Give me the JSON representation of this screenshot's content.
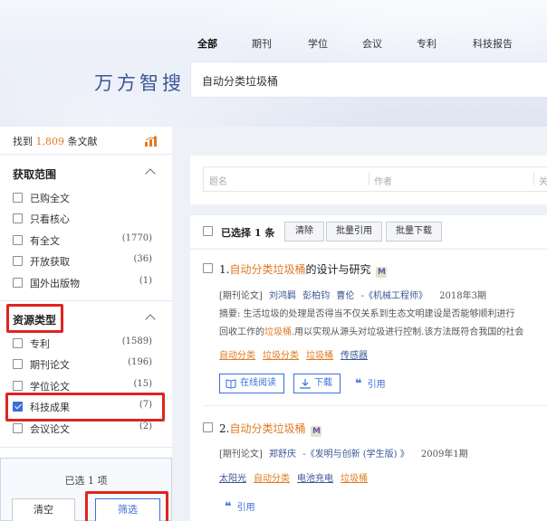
{
  "nav": [
    "全部",
    "期刊",
    "学位",
    "会议",
    "专利",
    "科技报告"
  ],
  "logo": "万方智搜",
  "search": {
    "value": "自动分类垃圾桶"
  },
  "found": {
    "prefix": "找到",
    "count": "1,809",
    "suffix": "条文献"
  },
  "filters": {
    "scope": {
      "title": "获取范围",
      "items": [
        {
          "label": "已购全文",
          "count": ""
        },
        {
          "label": "只看核心",
          "count": ""
        },
        {
          "label": "有全文",
          "count": "(1770)"
        },
        {
          "label": "开放获取",
          "count": "(36)"
        },
        {
          "label": "国外出版物",
          "count": "(1)"
        }
      ]
    },
    "type": {
      "title": "资源类型",
      "items": [
        {
          "label": "专利",
          "count": "(1589)",
          "checked": false
        },
        {
          "label": "期刊论文",
          "count": "(196)",
          "checked": false
        },
        {
          "label": "学位论文",
          "count": "(15)",
          "checked": false
        },
        {
          "label": "科技成果",
          "count": "(7)",
          "checked": true
        },
        {
          "label": "会议论文",
          "count": "(2)",
          "checked": false
        }
      ]
    }
  },
  "selection": {
    "text": "已选 1 项",
    "clear": "清空",
    "filter": "筛选"
  },
  "advanced": {
    "title_ph": "题名",
    "author_ph": "作者",
    "key_ph": "关"
  },
  "toolbar": {
    "selected": "已选择 1 条",
    "clear": "清除",
    "batch_cite": "批量引用",
    "batch_download": "批量下载"
  },
  "results": [
    {
      "num": "1.",
      "title_hl": "自动分类垃圾桶",
      "title_rest": "的设计与研究",
      "badge": "M",
      "type": "[期刊论文]",
      "authors": [
        "刘鸿羁",
        "彭柏钧",
        "曹伦"
      ],
      "journal": "-《机械工程师》",
      "date": "2018年3期",
      "abstract_1": "摘要: 生活垃圾的处理是否得当不仅关系到生态文明建设是否能够顺利进行",
      "abstract_2_pre": "回收工作的",
      "abstract_2_hl": "垃圾桶",
      "abstract_2_post": ".用以实现从源头对垃圾进行控制.该方法既符合我国的社会",
      "keywords": [
        {
          "text": "自动分类",
          "hl": true
        },
        {
          "text": "垃圾分类",
          "hl": true
        },
        {
          "text": "垃圾桶",
          "hl": true
        },
        {
          "text": "传感器",
          "hl": false
        }
      ],
      "actions": {
        "read": "在线阅读",
        "download": "下载",
        "cite": "引用"
      }
    },
    {
      "num": "2.",
      "title_hl": "自动分类垃圾桶",
      "title_rest": "",
      "badge": "M",
      "type": "[期刊论文]",
      "authors": [
        "郑舒庆"
      ],
      "journal": "-《发明与创新 (学生版) 》",
      "date": "2009年1期",
      "keywords": [
        {
          "text": "太阳光",
          "hl": false
        },
        {
          "text": "自动分类",
          "hl": true
        },
        {
          "text": "电池充电",
          "hl": false
        },
        {
          "text": "垃圾桶",
          "hl": true
        }
      ],
      "actions": {
        "cite": "引用"
      }
    }
  ],
  "colors": {
    "accent": "#3a6fd8",
    "highlight": "#e07a23",
    "annotation": "#e02420",
    "logo": "#3a5796"
  }
}
